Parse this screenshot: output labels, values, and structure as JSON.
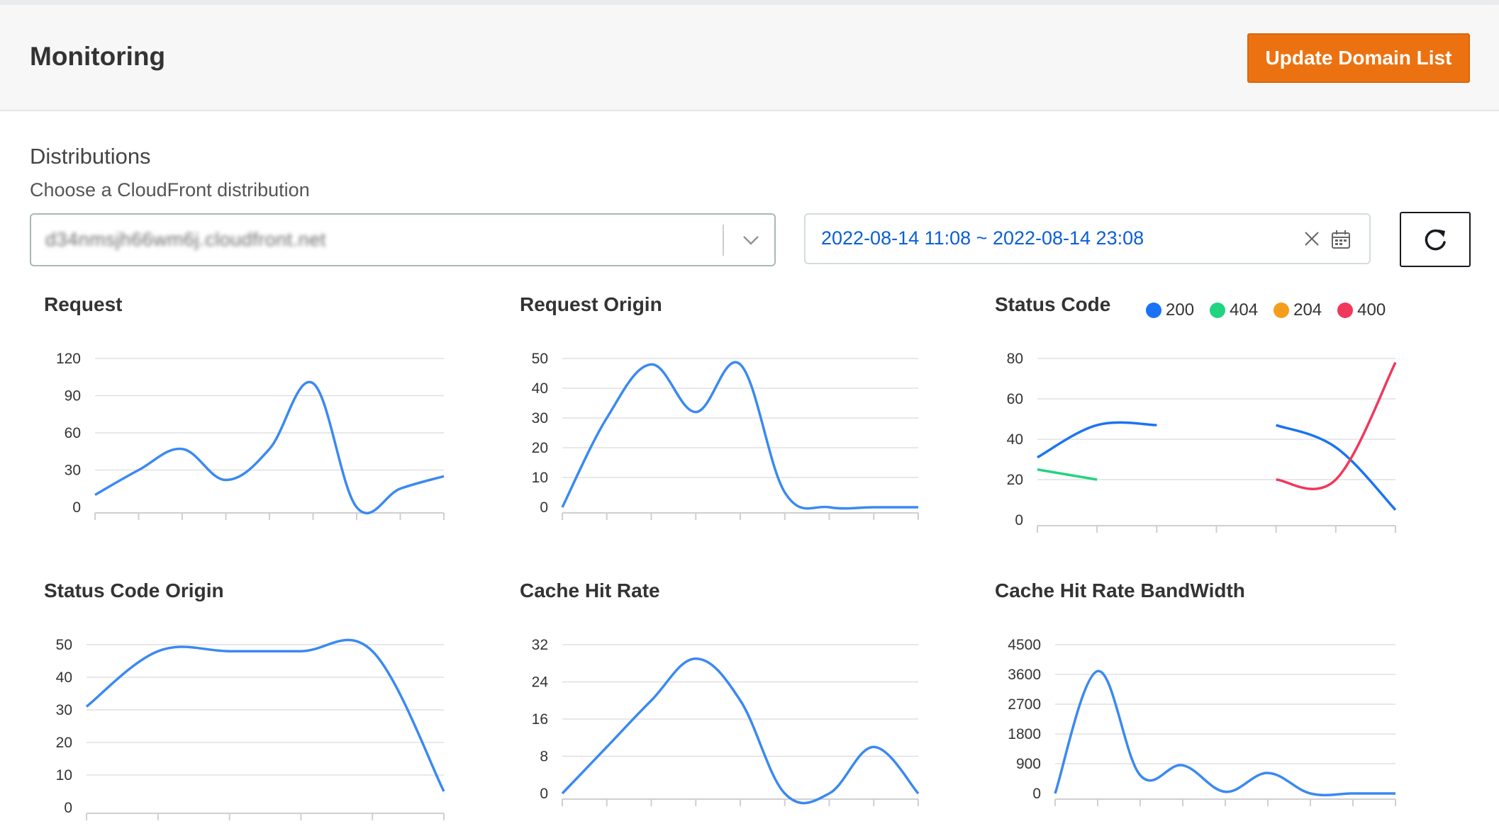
{
  "header": {
    "title": "Monitoring",
    "update_button": "Update Domain List"
  },
  "distributions": {
    "title": "Distributions",
    "description": "Choose a CloudFront distribution",
    "selected": "d34nmsjh66wm6j.cloudfront.net"
  },
  "date_range": {
    "value": "2022-08-14 11:08 ~ 2022-08-14 23:08"
  },
  "icons": {
    "select": "chevron-down-icon",
    "clear": "close-icon",
    "calendar": "calendar-icon",
    "refresh": "refresh-icon"
  },
  "colors": {
    "accent": "#ec7211",
    "line": "#3a89f1",
    "s200": "#1a73f5",
    "s404": "#21d47f",
    "s204": "#f59e1b",
    "s400": "#f0385a"
  },
  "legend": [
    {
      "label": "200",
      "color": "#1a73f5"
    },
    {
      "label": "404",
      "color": "#21d47f"
    },
    {
      "label": "204",
      "color": "#f59e1b"
    },
    {
      "label": "400",
      "color": "#f0385a"
    }
  ],
  "chart_data": [
    {
      "type": "line",
      "title": "Request",
      "yticks": [
        0,
        30,
        60,
        90,
        120
      ],
      "ylim": [
        0,
        120
      ],
      "series": [
        {
          "values": [
            10,
            30,
            47,
            22,
            47,
            100,
            0,
            15,
            25
          ],
          "color": "#3a89f1"
        }
      ]
    },
    {
      "type": "line",
      "title": "Request Origin",
      "yticks": [
        0,
        10,
        20,
        30,
        40,
        50
      ],
      "ylim": [
        0,
        50
      ],
      "series": [
        {
          "values": [
            0,
            30,
            48,
            32,
            48,
            5,
            0,
            0,
            0
          ],
          "color": "#3a89f1"
        }
      ]
    },
    {
      "type": "line",
      "title": "Status Code",
      "yticks": [
        0,
        20,
        40,
        60,
        80
      ],
      "ylim": [
        0,
        80
      ],
      "series": [
        {
          "name": "200",
          "color": "#1a73f5",
          "values": [
            31,
            47,
            47,
            null,
            47,
            36,
            5
          ]
        },
        {
          "name": "404",
          "color": "#21d47f",
          "values": [
            25,
            20,
            null,
            null,
            null,
            null,
            null
          ]
        },
        {
          "name": "400",
          "color": "#f0385a",
          "values": [
            null,
            null,
            null,
            null,
            20,
            20,
            78
          ]
        }
      ]
    },
    {
      "type": "line",
      "title": "Status Code Origin",
      "yticks": [
        0,
        10,
        20,
        30,
        40,
        50
      ],
      "ylim": [
        0,
        50
      ],
      "series": [
        {
          "values": [
            31,
            48,
            48,
            48,
            48,
            5
          ],
          "color": "#3a89f1"
        }
      ]
    },
    {
      "type": "line",
      "title": "Cache Hit Rate",
      "yticks": [
        0,
        8,
        16,
        24,
        32
      ],
      "ylim": [
        0,
        32
      ],
      "series": [
        {
          "values": [
            0,
            10,
            20,
            29,
            20,
            0,
            0,
            10,
            0
          ],
          "color": "#3a89f1"
        }
      ]
    },
    {
      "type": "line",
      "title": "Cache Hit Rate BandWidth",
      "yticks": [
        0,
        900,
        1800,
        2700,
        3600,
        4500
      ],
      "ylim": [
        0,
        4500
      ],
      "series": [
        {
          "values": [
            0,
            3700,
            550,
            850,
            50,
            620,
            0,
            0,
            0
          ],
          "color": "#3a89f1"
        }
      ]
    }
  ]
}
